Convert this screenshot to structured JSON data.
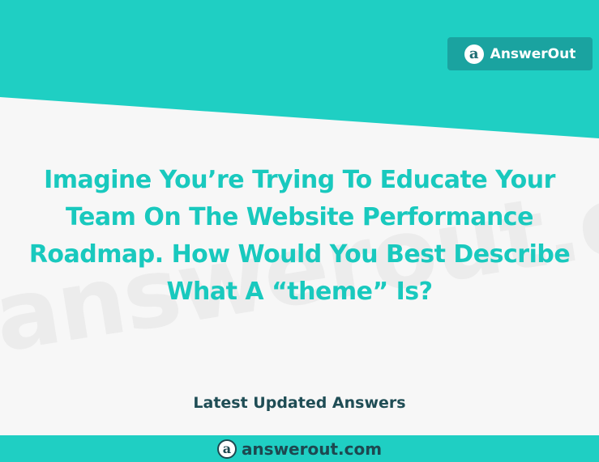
{
  "brand": {
    "name": "AnswerOut",
    "logo_letter": "a"
  },
  "watermark": {
    "text": "answerout.com"
  },
  "question": {
    "text": "Imagine You’re Trying To Educate Your Team On The Website Performance Roadmap. How Would You Best Describe What A “theme” Is?"
  },
  "section": {
    "label": "Latest Updated Answers"
  },
  "footer": {
    "site": "answerout.com",
    "logo_letter": "a"
  },
  "colors": {
    "teal": "#1fcfc3",
    "teal_dark": "#1aa3a0",
    "navy": "#1f4d55"
  }
}
